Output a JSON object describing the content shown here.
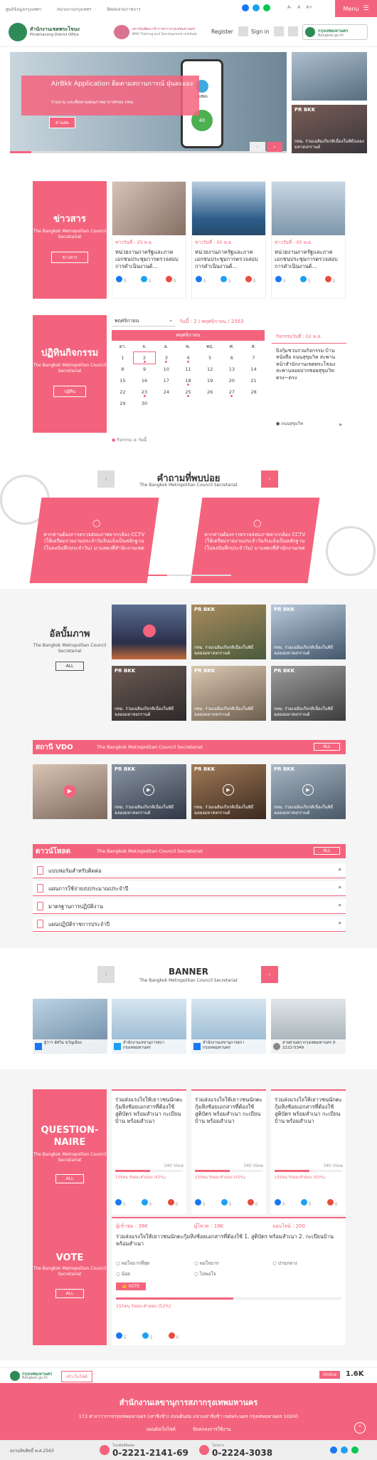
{
  "top": {
    "links": [
      "ศูนย์ข้อมูลกรุงเทพฯ",
      "หน่วยงานกรุงเทพฯ",
      "ติดต่อส่วนราชการ"
    ],
    "font_controls": [
      "A-",
      "A",
      "A+"
    ],
    "menu_label": "Menu"
  },
  "header": {
    "org_th": "สำนักงานเขตพระโขนง",
    "org_en": "Phrakhanong District Office",
    "institute_th": "สถาบันพัฒนาข้าราชการกรุงเทพมหานคร",
    "institute_en": "BMA Training and Development Institute",
    "register": "Register",
    "sign_in": "Sign in",
    "bkk_logo": "กรุงเทพมหานคร",
    "bkk_url": "Bangkok.go.th"
  },
  "hero": {
    "title": "AirBkk Application ติดตามสถานการณ์ ฝุ่นละออง",
    "subtitle": "รายงาน และติดตามคุณภาพอากาศของ กทม.",
    "button": "อ่านต่อ",
    "app_name": "AirBkk",
    "aqi": "40",
    "side_tag": "PR BKK",
    "side_caption": "กทม. ร่วมเฉลิมเกียรติเนื่องในพิธีฉลองมหาสงกรานต์"
  },
  "news": {
    "title": "ข่าวสาร",
    "subtitle": "The Bangkok Metropolitan Council Secretariat",
    "button": "ข่าวสาร",
    "cards": [
      {
        "date": "ข่าววันที่ : 25 พ.ย.",
        "text": "หน่วยงานภาครัฐและภาคเอกชนประชุมการตรวจสอบการดำเนินงานด้..."
      },
      {
        "date": "ข่าววันที่ : 05 พ.ย.",
        "text": "หน่วยงานภาครัฐและภาคเอกชนประชุมการตรวจสอบการดำเนินงานด้..."
      },
      {
        "date": "ข่าววันที่ : 05 พ.ย.",
        "text": "หน่วยงานภาครัฐและภาคเอกชนประชุมการตรวจสอบการดำเนินงานด้..."
      }
    ],
    "share_counts": [
      "5",
      "5",
      "0"
    ]
  },
  "activity": {
    "title": "ปฏิทินกิจกรรม",
    "subtitle": "The Bangkok Metropolitan Council Secretariat",
    "button": "ปฏิทิน",
    "month_select": "พฤศจิกายน",
    "today_label": "วันนี้ : 2 / พฤศจิกายน / 2563",
    "cal_header": "พฤศจิกายน",
    "weekdays": [
      "อา.",
      "จ.",
      "อ.",
      "พ.",
      "พฤ.",
      "ศ.",
      "ส."
    ],
    "weeks": [
      [
        "1",
        "2",
        "3",
        "4",
        "5",
        "6",
        "7"
      ],
      [
        "8",
        "9",
        "10",
        "11",
        "12",
        "13",
        "14"
      ],
      [
        "15",
        "16",
        "17",
        "18",
        "19",
        "20",
        "21"
      ],
      [
        "22",
        "23",
        "24",
        "25",
        "26",
        "27",
        "28"
      ],
      [
        "29",
        "30",
        "",
        "",
        "",
        "",
        ""
      ]
    ],
    "legend_event": "กิจกรรม",
    "legend_today": "วันนี้",
    "event_date": "กิจกรรมวันที่ : 02 พ.ย.",
    "event_text": "ปิงกุ้มชวนร่วมกิจกรรม บ้านหนังสือ ถนนสุขุมวิท สะพานหน้าสำนักงานเขตพระโขนง สะพานลอยปากซอยสุขุมวิท ตรง~ตรง",
    "event_location": "ถนนสุขุมวิท"
  },
  "faq": {
    "title": "คำถามที่พบบ่อย",
    "subtitle": "The Bangkok Metropolitan Council Secretariat",
    "items": [
      "หากท่านต้องการตรวจสอบภาพจากกล้อง CCTV (ให้เตรียมรายงานประจำวันรับแจ้งเป็นหลักฐาน (ใบลงบันทึกประจำวัน) มาแสดงที่สำนักงานเขต",
      "หากท่านต้องการตรวจสอบภาพจากกล้อง CCTV (ให้เตรียมรายงานประจำวันรับแจ้งเป็นหลักฐาน (ใบลงบันทึกประจำวัน) มาแสดงที่สำนักงานเขต"
    ]
  },
  "album": {
    "title": "อัลบั้มภาพ",
    "subtitle": "The Bangkok Metropolitan Council Secretariat",
    "button": "ALL",
    "tag": "PR BKK",
    "caption": "กทม. ร่วมเฉลิมเกียรติเนื่องในพิธีฉลองมหาสงกรานต์"
  },
  "vdo": {
    "title": "สถานี VDO",
    "subtitle": "The Bangkok Metropolitan Council Secretariat",
    "button": "ALL",
    "tag": "PR BKK",
    "caption": "กทม. ร่วมเฉลิมเกียรติเนื่องในพิธีฉลองมหาสงกรานต์"
  },
  "download": {
    "title": "ดาวน์โหลด",
    "subtitle": "The Bangkok Metropolitan Council Secretariat",
    "button": "ALL",
    "items": [
      "แบบฟอร์มสำหรับติดต่อ",
      "แผนการใช้จ่ายงบประมาณประจำปี",
      "มาตรฐานการปฏิบัติงาน",
      "แผนปฏิบัติราชการประจำปี"
    ]
  },
  "banner": {
    "title": "BANNER",
    "subtitle": "The Bangkok Metropolitan Council Secretariat",
    "items": [
      "ผู้ว่าฯ อัศวิน ขวัญเมือง",
      "สำนักงานเลขานุการสภากรุงเทพมหานคร",
      "สำนักงานเลขานุการสภากรุงเทพมหานคร",
      "สายด่วนสภากรุงเทพมหานคร 0-2222-5349"
    ]
  },
  "questionnaire": {
    "title": "QUESTION-NAIRE",
    "subtitle": "The Bangkok Metropolitan Council Secretariat",
    "button": "ALL",
    "cards": [
      {
        "text": "ร่วมส่งแรงใจให้เยาวชนนักตะกุ้มหิงช้อยเอกสารที่ต้องใช้ สูติบัตร พร้อมสำเนา กะเบียนบ้าน พร้อมสำเนา",
        "views": "340 View",
        "progress": 0.52,
        "percent_text": "155คน ร้อยละคำตอบ (52%)"
      },
      {
        "text": "ร่วมส่งแรงใจให้เยาวชนนักตะกุ้มหิงช้อยเอกสารที่ต้องใช้ สูติบัตร พร้อมสำเนา กะเบียนบ้าน พร้อมสำเนา",
        "views": "340 View",
        "progress": 0.52,
        "percent_text": "155คน ร้อยละคำตอบ (52%)"
      },
      {
        "text": "ร่วมส่งแรงใจให้เยาวชนนักตะกุ้มหิงช้อยเอกสารที่ต้องใช้ สูติบัตร พร้อมสำเนา กะเบียนบ้าน พร้อมสำเนา",
        "views": "340 View",
        "progress": 0.52,
        "percent_text": "155คน ร้อยละคำตอบ (52%)"
      }
    ],
    "share_counts": [
      "5",
      "5",
      "0"
    ]
  },
  "vote": {
    "title": "VOTE",
    "subtitle": "The Bangkok Metropolitan Council Secretariat",
    "button": "ALL",
    "stats": [
      "ผู้เข้าชม : 36K",
      "ผู้โหวต : 16K",
      "ออนไลน์ : 200"
    ],
    "question": "ร่วมส่งแรงใจให้เยาวชนนักตะกุ้มหิงช้อยเอกสารที่ต้องใช้ 1. สูติบัตร พร้อมสำเนา 2. กะเบียนบ้าน พร้อมสำเนา",
    "options": [
      "พอใจมากที่สุด",
      "พอใจมาก",
      "ปานกลาง",
      "น้อย",
      "ไม่พอใจ"
    ],
    "vote_button": "VOTE",
    "progress": 0.52,
    "percent_text": "155คน ร้อยละคำตอบ (52%)",
    "share_counts": [
      "5",
      "5",
      "0"
    ]
  },
  "footer": {
    "bkk_logo": "กรุงเทพมหานคร",
    "bkk_url": "Bangkok.go.th",
    "visitor_btn": "เข้าเว็บไซต์",
    "online_label": "Online",
    "online_count": "1.6K",
    "org": "สำนักงานเลขานุการสภากรุงเทพมหานคร",
    "address": "173 ศาลาว่าการกรุงเทพมหานคร (เสาชิงช้า) ถนนดินสอ แขวงเสาชิงช้า เขตพระนคร กรุงเทพมหานคร 10200",
    "links": [
      "แผนผังเว็บไซต์",
      "ข้อตกลงการใช้งาน"
    ],
    "copyright": "สงวนลิขสิทธิ์ พ.ศ.2563",
    "tel_label": "โทรศัพท์ติดต่อ",
    "tel": "0-2221-2141-69",
    "fax_label": "โทรสาร",
    "fax": "0-2224-3038"
  }
}
